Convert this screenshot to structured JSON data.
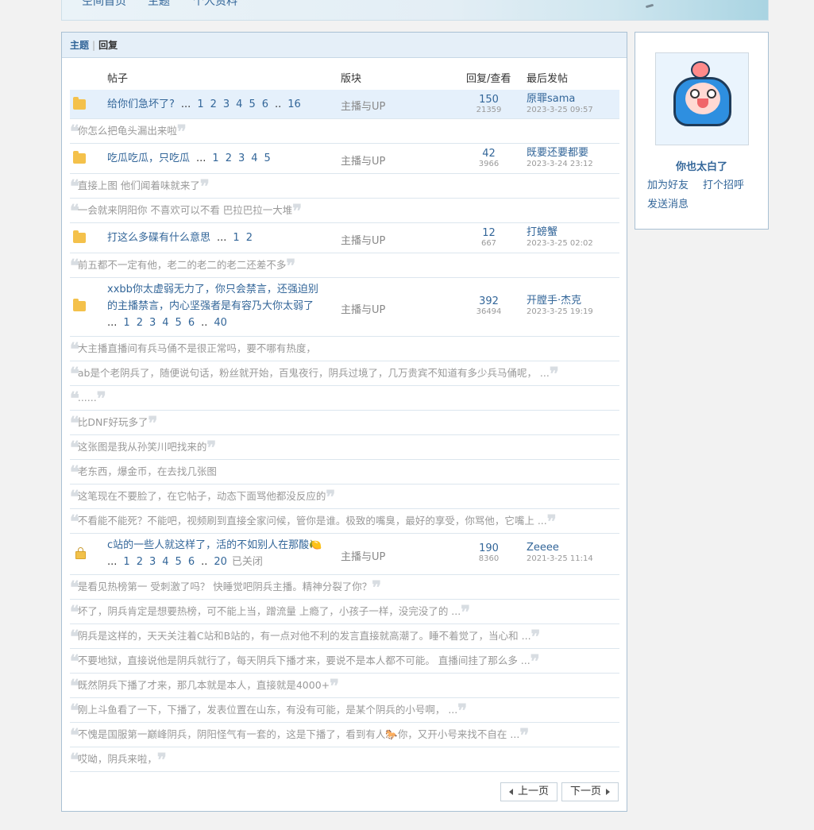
{
  "nav": {
    "items": [
      "空间首页",
      "主题",
      "个人资料"
    ]
  },
  "tabs": [
    {
      "label": "主题"
    },
    {
      "label": "回复"
    }
  ],
  "thead": {
    "post": "帖子",
    "board": "版块",
    "counts": "回复/查看",
    "last": "最后发帖"
  },
  "threads": [
    {
      "title": "给你们急坏了?",
      "pages": [
        "1",
        "2",
        "3",
        "4",
        "5",
        "6"
      ],
      "last_page": "16",
      "board": "主播与UP",
      "replies": "150",
      "views": "21359",
      "last_user": "原罪sama",
      "last_time": "2023-3-25 09:57",
      "replies_list": [
        "你怎么把龟头漏出来啦"
      ]
    },
    {
      "title": "吃瓜吃瓜，只吃瓜",
      "pages": [
        "1",
        "2",
        "3",
        "4",
        "5"
      ],
      "board": "主播与UP",
      "replies": "42",
      "views": "3966",
      "last_user": "既要还要都要",
      "last_time": "2023-3-24 23:12",
      "replies_list": [
        "直接上图 他们闻着味就来了",
        "一会就来阴阳你 不喜欢可以不看 巴拉巴拉一大堆"
      ]
    },
    {
      "title": "打这么多碟有什么意思",
      "pages": [
        "1",
        "2"
      ],
      "board": "主播与UP",
      "replies": "12",
      "views": "667",
      "last_user": "打螃蟹",
      "last_time": "2023-3-25 02:02",
      "replies_list": [
        "前五都不一定有他，老二的老二的老二还差不多"
      ]
    },
    {
      "title_line1": "xxbb你太虚弱无力了，你只会禁言，还强迫别",
      "title_line2": "的主播禁言，内心坚强者是有容乃大你太弱了",
      "pages": [
        "1",
        "2",
        "3",
        "4",
        "5",
        "6"
      ],
      "last_page": "40",
      "board": "主播与UP",
      "replies": "392",
      "views": "36494",
      "last_user": "开膛手·杰克",
      "last_time": "2023-3-25 19:19",
      "replies_list": [
        "大主播直播间有兵马俑不是很正常吗，要不哪有热度，",
        "ab是个老阴兵了，随便说句话，粉丝就开始，百鬼夜行，阴兵过境了，几万贵宾不知道有多少兵马俑呢， ...",
        "......",
        "比DNF好玩多了",
        "这张图是我从孙笑川吧找来的",
        "老东西，爆金币，在去找几张图",
        "这笔现在不要脸了，在它帖子，动态下面骂他都没反应的",
        "不看能不能死？不能吧，视频刷到直接全家问候，管你是谁。极致的嘴臭，最好的享受，你骂他，它嘴上 ..."
      ]
    },
    {
      "title": "c站的一些人就这样了，活的不如别人在那酸🍋",
      "pages": [
        "1",
        "2",
        "3",
        "4",
        "5",
        "6"
      ],
      "last_page": "20",
      "closed": "已关闭",
      "board": "主播与UP",
      "replies": "190",
      "views": "8360",
      "last_user": "Zeeee",
      "last_time": "2021-3-25 11:14",
      "replies_list": [
        "是看见热榜第一 受刺激了吗？ 快睡觉吧阴兵主播。精神分裂了你？",
        "坏了，阴兵肯定是想要热榜，可不能上当，蹭流量 上瘾了，小孩子一样，没完没了的 ...",
        "阴兵是这样的，天天关注着C站和B站的，有一点对他不利的发言直接就高潮了。睡不着觉了，当心和 ...",
        "不要地狱，直接说他是阴兵就行了，每天阴兵下播才来，要说不是本人都不可能。 直播间挂了那么多 ...",
        "既然阴兵下播了才来，那几本就是本人，直接就是4000+",
        "刚上斗鱼看了一下，下播了，发表位置在山东，有没有可能，是某个阴兵的小号啊， ...",
        "不愧是国服第一巅峰阴兵，阴阳怪气有一套的，这是下播了，看到有人🐎你，又开小号来找不自在 ...",
        "哎呦，阴兵来啦，"
      ]
    }
  ],
  "pager": {
    "prev": "上一页",
    "next": "下一页"
  },
  "profile": {
    "name": "你也太白了",
    "add_friend": "加为好友",
    "greet": "打个招呼",
    "message": "发送消息"
  },
  "colors": {
    "link": "#336699",
    "highlight_row": "#e5f0fb",
    "panel_border": "#a9c0d3"
  }
}
